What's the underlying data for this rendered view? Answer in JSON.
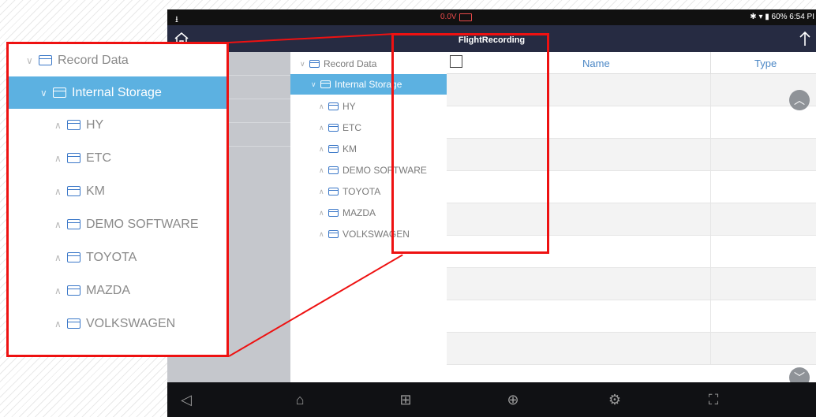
{
  "status": {
    "left_glyph": "⭳",
    "voltage": "0.0V",
    "right": "✱ ▾ ▮ 60% 6:54 PI"
  },
  "titlebar": {
    "title": "FlightRecording"
  },
  "tree": {
    "root": "Record Data",
    "selected": "Internal Storage",
    "children": [
      "HY",
      "ETC",
      "KM",
      "DEMO SOFTWARE",
      "TOYOTA",
      "MAZDA",
      "VOLKSWAGEN"
    ]
  },
  "table": {
    "col_name": "Name",
    "col_type": "Type"
  },
  "navbar": {
    "back_icon": "back-icon",
    "home_icon": "home-icon",
    "apps_icon": "apps-icon",
    "browser_icon": "globe-icon",
    "settings_icon": "settings-icon",
    "screenshot_icon": "screenshot-icon"
  },
  "colors": {
    "accent": "#5cb1e1",
    "titlebar": "#262b42",
    "highlight": "#e11111",
    "folder": "#3b78c8"
  }
}
